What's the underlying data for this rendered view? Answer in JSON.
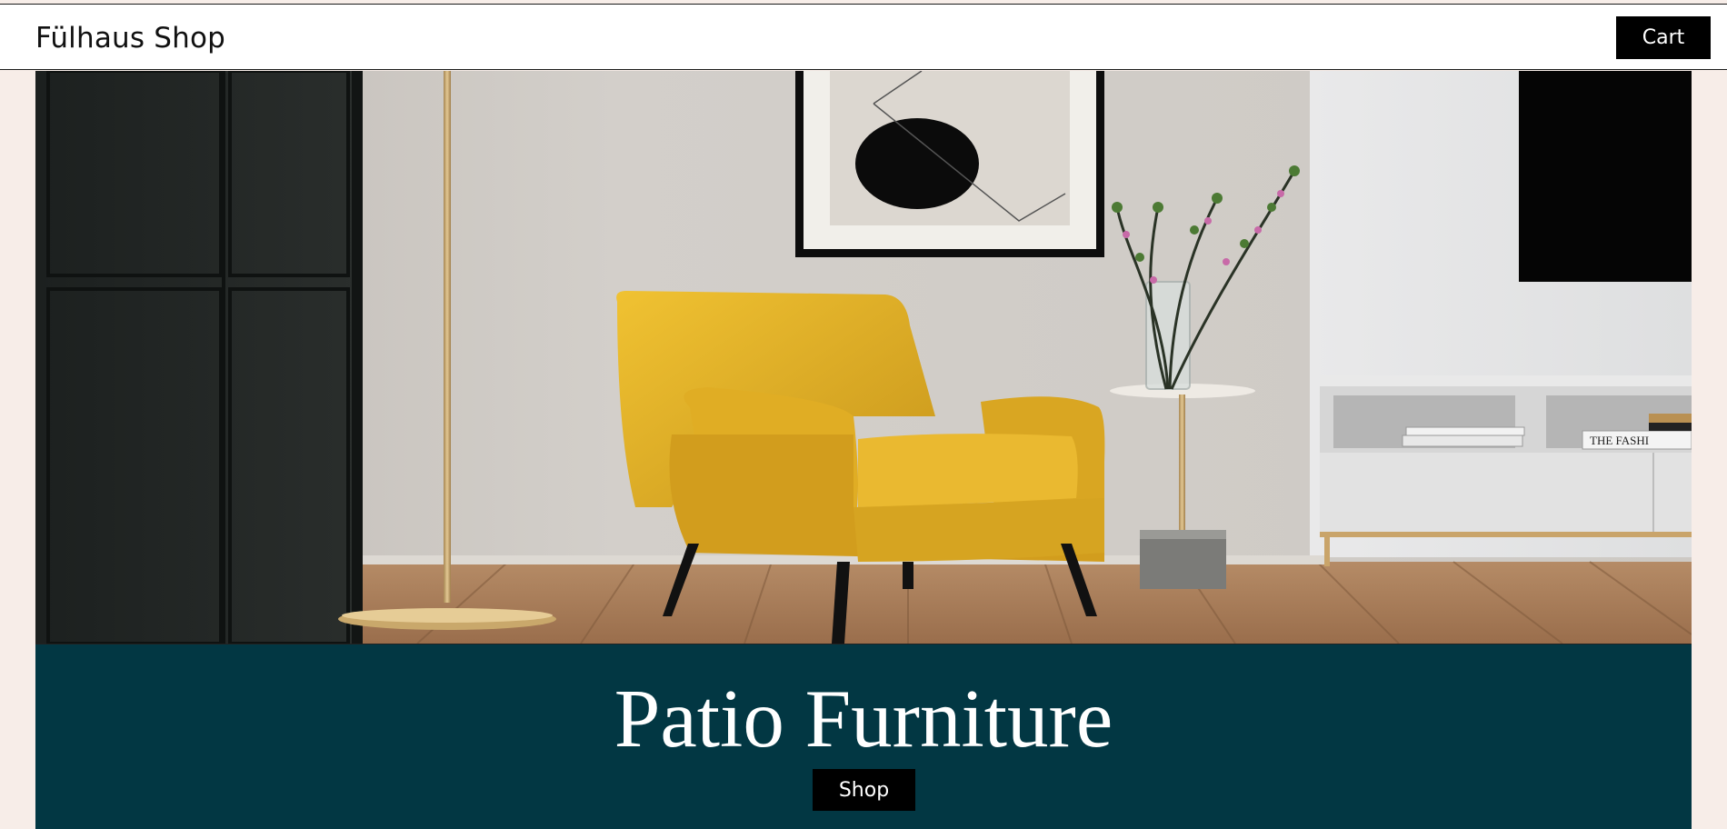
{
  "header": {
    "brand": "Fülhaus Shop",
    "cart_label": "Cart"
  },
  "hero": {
    "book_spine_text": "THE FASHI"
  },
  "banner": {
    "title": "Patio Furniture",
    "shop_label": "Shop"
  },
  "colors": {
    "page_background": "#f7ede8",
    "banner_background": "#023743",
    "button_background": "#000000",
    "chair_yellow": "#e6b52a"
  }
}
